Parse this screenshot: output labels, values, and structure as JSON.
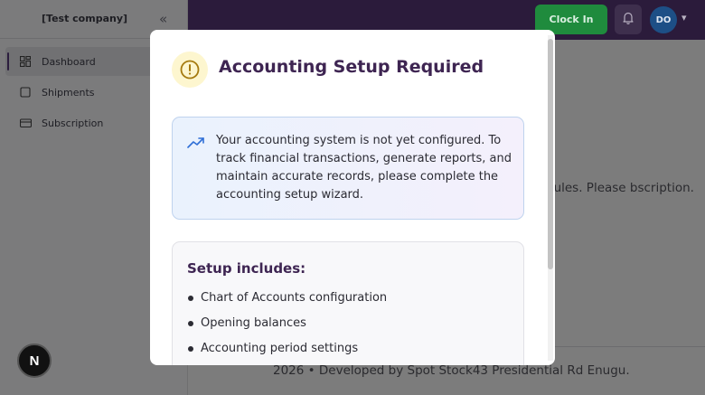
{
  "sidebar": {
    "company": "[Test company]",
    "collapse_icon": "double-chevron-left-icon",
    "items": [
      {
        "label": "Dashboard",
        "icon": "dashboard-icon",
        "active": true
      },
      {
        "label": "Shipments",
        "icon": "box-icon",
        "active": false
      },
      {
        "label": "Subscription",
        "icon": "credit-card-icon",
        "active": false
      }
    ]
  },
  "topbar": {
    "clock_in_label": "Clock In",
    "bell_icon": "bell-icon",
    "avatar_initials": "DO",
    "avatar_chevron": "▾"
  },
  "background": {
    "main_text": "dules. Please bscription.",
    "footer": "2026  •  Developed by Spot Stock43 Presidential Rd Enugu."
  },
  "next_badge": "N",
  "modal": {
    "title": "Accounting Setup Required",
    "warning_icon": "alert-circle-icon",
    "info_icon": "trending-up-icon",
    "info_text": "Your accounting system is not yet configured. To track financial transactions, generate reports, and maintain accurate records, please complete the accounting setup wizard.",
    "setup_title": "Setup includes:",
    "setup_items": [
      "Chart of Accounts configuration",
      "Opening balances",
      "Accounting period settings"
    ]
  },
  "colors": {
    "topbar": "#2b1b3b",
    "clock_in": "#1f8b3d",
    "avatar": "#1d4f86",
    "title": "#3e2552",
    "info_border": "#bfd3ee"
  }
}
